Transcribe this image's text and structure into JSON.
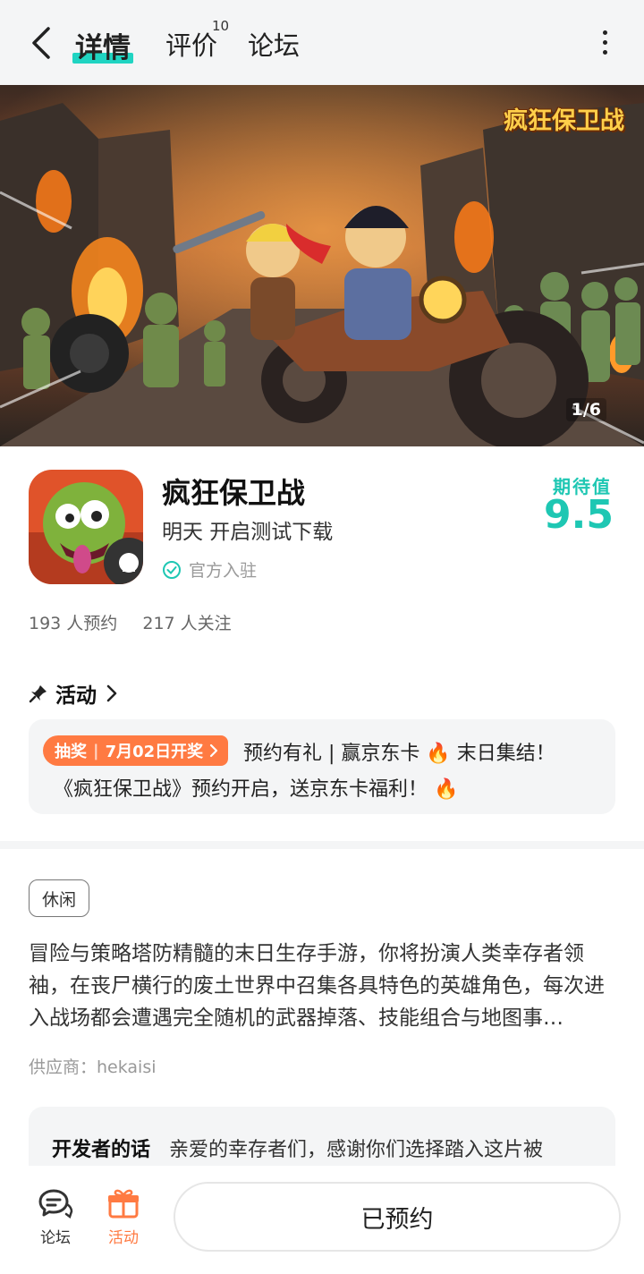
{
  "nav": {
    "tabs": [
      {
        "label": "详情"
      },
      {
        "label": "评价",
        "badge": "10"
      },
      {
        "label": "论坛"
      }
    ],
    "accent": "#20d4c2"
  },
  "banner": {
    "logo_text": "疯狂保卫战",
    "page_indicator": "1/6"
  },
  "app": {
    "name": "疯狂保卫战",
    "status": "明天 开启测试下载",
    "official": "官方入驻",
    "expect_label": "期待值",
    "expect_score": "9.5",
    "reservations": "193 人预约",
    "followers": "217 人关注"
  },
  "activity": {
    "heading": "活动",
    "badge_type": "抽奖",
    "badge_date": "7月02日开奖",
    "line1": "预约有礼 | 赢京东卡 🔥 末日集结！",
    "line2": "《疯狂保卫战》预约开启，送京东卡福利！ 🔥"
  },
  "detail": {
    "tag": "休闲",
    "description": "冒险与策略塔防精髓的末日生存手游，你将扮演人类幸存者领袖，在丧尸横行的废土世界中召集各具特色的英雄角色，每次进入战场都会遭遇完全随机的武器掉落、技能组合与地图事…",
    "supplier": "供应商：hekaisi",
    "dev_title": "开发者的话",
    "dev_text": "亲爱的幸存者们，感谢你们选择踏入这片被"
  },
  "bottom": {
    "forum_label": "论坛",
    "activity_label": "活动",
    "reserve_label": "已预约"
  }
}
